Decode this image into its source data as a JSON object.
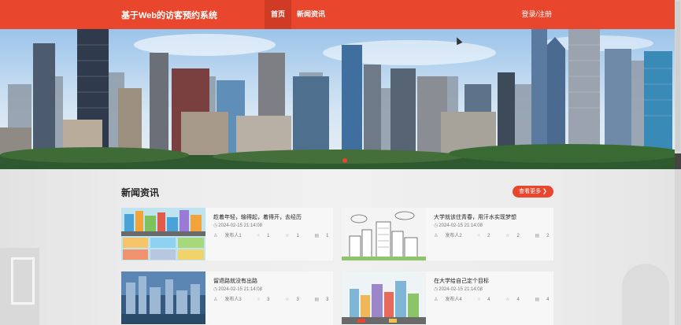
{
  "header": {
    "brand": "基于Web的访客预约系统",
    "nav": [
      {
        "label": "首页"
      },
      {
        "label": "新闻资讯"
      }
    ],
    "login": "登录/注册",
    "bg_color": "#e8472e"
  },
  "section": {
    "title": "新闻资讯",
    "more": "查看更多 ❯"
  },
  "news": [
    {
      "title": "趁着年轻，输得起，着得开，去经历",
      "date": "2024-02-15 21:14:08",
      "author": "发布人1",
      "likes": "1",
      "favorites": "1",
      "comments": "1"
    },
    {
      "title": "大学就该住青春，用汗水实现梦想",
      "date": "2024-02-15 21:14:08",
      "author": "发布人2",
      "likes": "2",
      "favorites": "2",
      "comments": "2"
    },
    {
      "title": "留退路就没有出路",
      "date": "2024-02-15 21:14:08",
      "author": "发布人3",
      "likes": "3",
      "favorites": "3",
      "comments": "3"
    },
    {
      "title": "在大学给自己定个目标",
      "date": "2024-02-15 21:14:08",
      "author": "发布人4",
      "likes": "4",
      "favorites": "4",
      "comments": "4"
    }
  ]
}
